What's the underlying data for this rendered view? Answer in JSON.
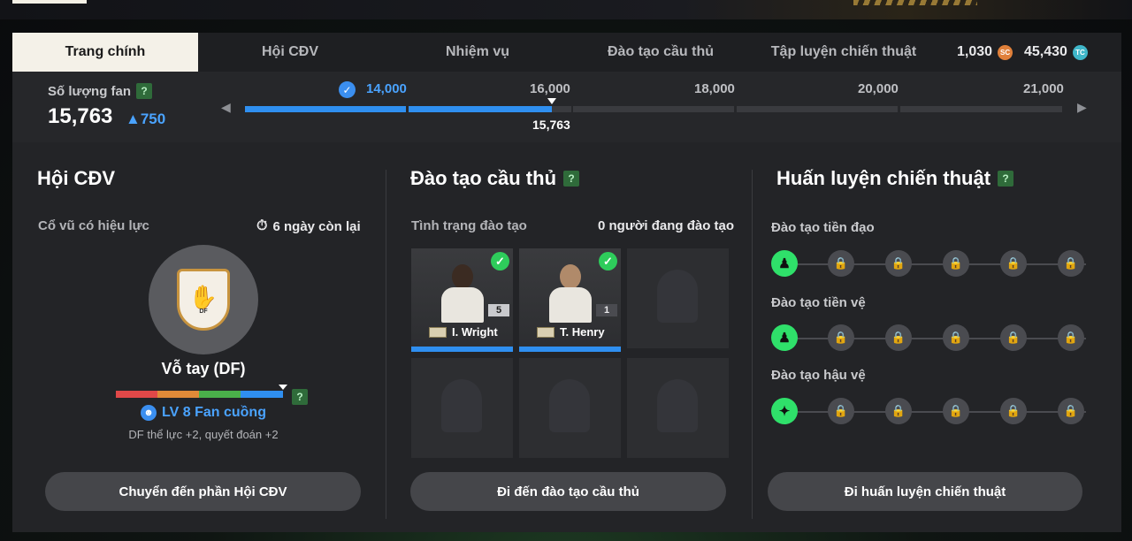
{
  "tabs": [
    {
      "label": "Trang chính",
      "active": true
    },
    {
      "label": "Hội CĐV",
      "active": false
    },
    {
      "label": "Nhiệm vụ",
      "active": false
    },
    {
      "label": "Đào tạo cầu thủ",
      "active": false
    },
    {
      "label": "Tập luyện chiến thuật",
      "active": false
    }
  ],
  "currency": {
    "sc_amount": "1,030",
    "sc_icon": "SC",
    "tc_amount": "45,430",
    "tc_icon": "TC"
  },
  "fan_progress": {
    "label": "Số lượng fan",
    "help": "?",
    "count": "15,763",
    "delta": "▲750",
    "milestones": [
      "14,000",
      "16,000",
      "18,000",
      "20,000",
      "21,000"
    ],
    "current_label": "15,763",
    "reached_color": "#2f8ff0"
  },
  "fan_club": {
    "title": "Hội CĐV",
    "active_chant_label": "Cổ vũ có hiệu lực",
    "time_left": "6 ngày còn lại",
    "badge_text": "DF",
    "chant_name": "Vỗ tay (DF)",
    "level_text": "LV 8 Fan cuồng",
    "level_help": "?",
    "effect": "DF thể lực +2, quyết đoán +2",
    "button": "Chuyển đến phần Hội CĐV"
  },
  "player_training": {
    "title": "Đào tạo cầu thủ",
    "help": "?",
    "status_label": "Tình trạng đào tạo",
    "training_count": "0 người đang đào tạo",
    "players": [
      {
        "name": "I. Wright",
        "level": "5",
        "done": true
      },
      {
        "name": "T. Henry",
        "level": "1",
        "done": true
      }
    ],
    "button": "Đi đến đào tạo cầu thủ"
  },
  "tactics": {
    "title": "Huấn luyện chiến thuật",
    "help": "?",
    "rows": [
      {
        "label": "Đào tạo tiền đạo"
      },
      {
        "label": "Đào tạo tiền vệ"
      },
      {
        "label": "Đào tạo hậu vệ"
      }
    ],
    "button": "Đi huấn luyện chiến thuật"
  },
  "colors": {
    "accent_blue": "#2f8ff0",
    "active_green": "#2fe06a",
    "check_green": "#2ecc5b"
  }
}
